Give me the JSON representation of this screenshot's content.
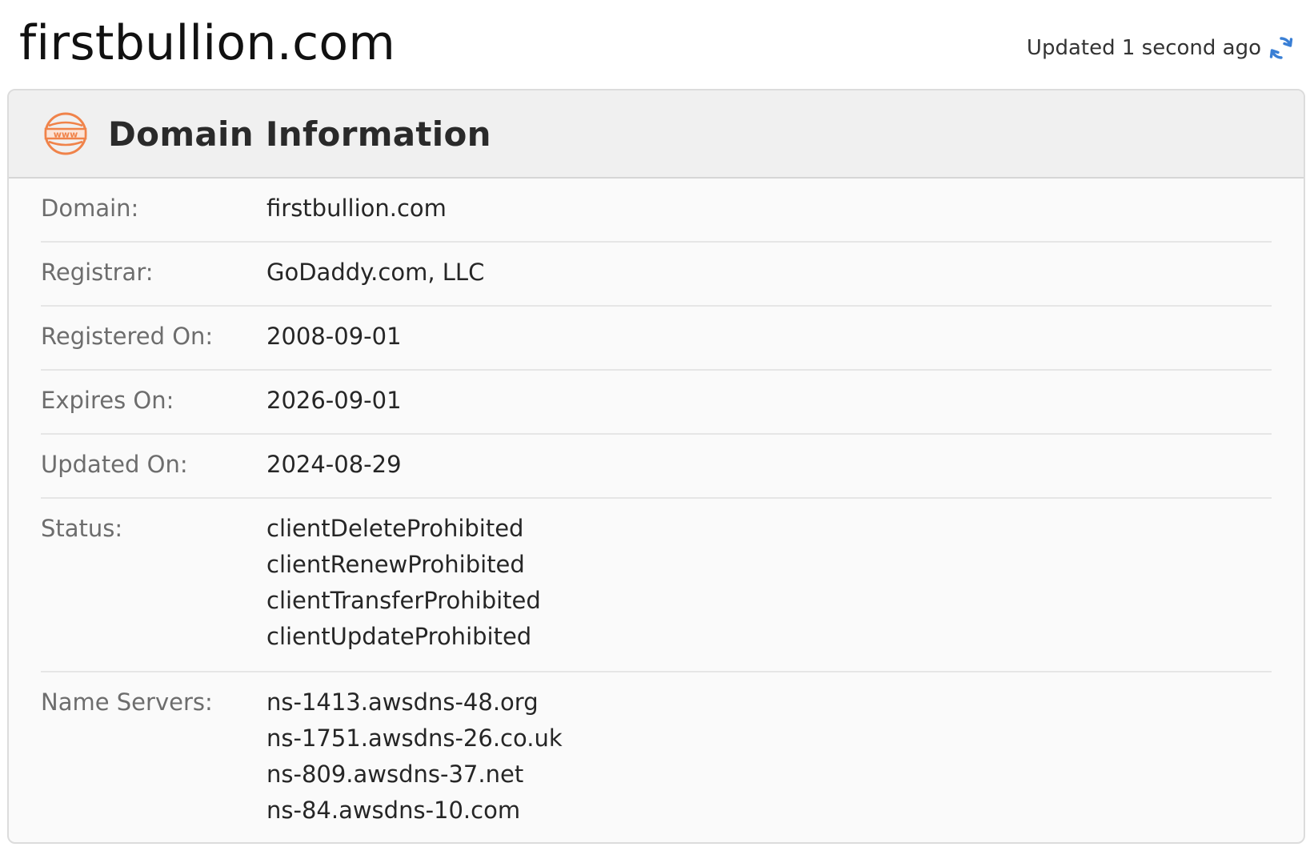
{
  "page": {
    "title": "firstbullion.com",
    "updated_text": "Updated 1 second ago",
    "refresh_icon": "refresh-icon",
    "accent_color": "#3a7fd5"
  },
  "card": {
    "icon": "www-icon",
    "icon_color": "#f0834a",
    "title": "Domain Information",
    "rows": [
      {
        "label": "Domain:",
        "value": "firstbullion.com"
      },
      {
        "label": "Registrar:",
        "value": "GoDaddy.com, LLC"
      },
      {
        "label": "Registered On:",
        "value": "2008-09-01"
      },
      {
        "label": "Expires On:",
        "value": "2026-09-01"
      },
      {
        "label": "Updated On:",
        "value": "2024-08-29"
      },
      {
        "label": "Status:",
        "values": [
          "clientDeleteProhibited",
          "clientRenewProhibited",
          "clientTransferProhibited",
          "clientUpdateProhibited"
        ]
      },
      {
        "label": "Name Servers:",
        "values": [
          "ns-1413.awsdns-48.org",
          "ns-1751.awsdns-26.co.uk",
          "ns-809.awsdns-37.net",
          "ns-84.awsdns-10.com"
        ]
      }
    ]
  }
}
